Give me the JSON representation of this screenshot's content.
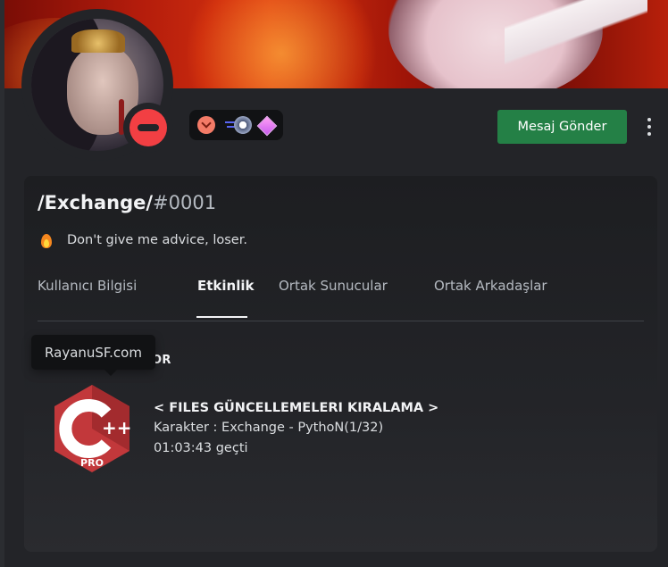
{
  "profile": {
    "username": "/Exchange/",
    "discriminator": "#0001",
    "custom_status": "Don't give me advice, loser.",
    "status": "do-not-disturb",
    "badges": [
      "hypesquad-badge-icon",
      "nitro-badge-icon",
      "server-boost-badge-icon"
    ]
  },
  "actions": {
    "message_button": "Mesaj Gönder",
    "more_icon": "more-vertical-icon"
  },
  "tabs": [
    {
      "label": "Kullanıcı Bilgisi",
      "active": false
    },
    {
      "label": "Etkinlik",
      "active": true
    },
    {
      "label": "Ortak Sunucular",
      "active": false
    },
    {
      "label": "Ortak Arkadaşlar",
      "active": false
    }
  ],
  "activity": {
    "header": "OR",
    "tooltip": "RayanuSF.com",
    "app_icon": "cpp-pro-icon",
    "icon_text": "PRO",
    "title": "< FILES GÜNCELLEMELERI KIRALAMA >",
    "details": "Karakter : Exchange - PythoN(1/32)",
    "elapsed": "01:03:43 geçti"
  },
  "colors": {
    "accent_green": "#248046",
    "dnd_red": "#f23f43",
    "background": "#232428"
  }
}
